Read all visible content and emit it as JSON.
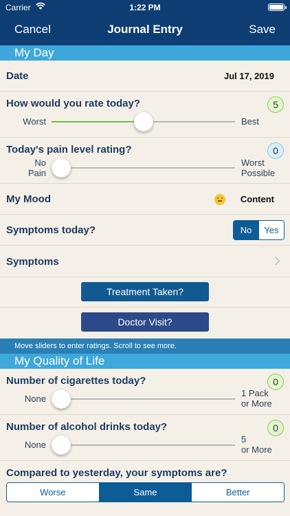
{
  "status_bar": {
    "carrier": "Carrier",
    "time": "1:22 PM"
  },
  "nav": {
    "cancel": "Cancel",
    "title": "Journal Entry",
    "save": "Save"
  },
  "sections": {
    "my_day": "My Day",
    "quality_of_life": "My Quality of Life"
  },
  "date_row": {
    "label": "Date",
    "value": "Jul 17, 2019"
  },
  "rating": {
    "label": "How would you rate today?",
    "value": "5",
    "slider_value": 5,
    "slider_min": 0,
    "slider_max": 10,
    "min_label": "Worst",
    "max_label": "Best"
  },
  "pain": {
    "label": "Today's pain level rating?",
    "value": "0",
    "slider_value": 0,
    "min_label": "No\nPain",
    "max_label": "Worst\nPossible"
  },
  "mood": {
    "label": "My Mood",
    "value": "Content",
    "icon": "smiley-face-icon"
  },
  "symptoms_today": {
    "label": "Symptoms today?",
    "options": [
      "No",
      "Yes"
    ],
    "selected": "No"
  },
  "symptoms_row": {
    "label": "Symptoms"
  },
  "buttons": {
    "treatment": "Treatment Taken?",
    "doctor": "Doctor Visit?"
  },
  "info": "Move sliders to enter ratings. Scroll to see more.",
  "cigarettes": {
    "label": "Number of cigarettes today?",
    "value": "0",
    "slider_value": 0,
    "min_label": "None",
    "max_label": "1 Pack\nor More"
  },
  "alcohol": {
    "label": "Number of alcohol drinks today?",
    "value": "0",
    "slider_value": 0,
    "min_label": "None",
    "max_label": "5\nor More"
  },
  "compare": {
    "label": "Compared to yesterday, your symptoms are?",
    "options": [
      "Worse",
      "Same",
      "Better"
    ],
    "selected": "Same"
  },
  "colors": {
    "nav": "#0d3d73",
    "section": "#3ea7dc",
    "info": "#2a7fb4",
    "button_treatment": "#115a91",
    "button_doctor": "#2c4a8a",
    "slider_fill": "#6ec04a",
    "badge_green": "#e3f5ce",
    "badge_blue": "#d7eff7"
  }
}
